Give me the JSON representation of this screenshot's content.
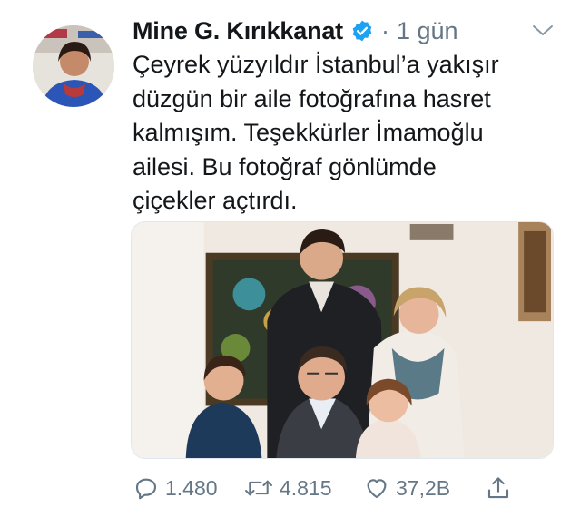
{
  "tweet": {
    "author": {
      "name": "Mine G. Kırıkkanat",
      "verified": true,
      "avatar_icon": "profile-photo"
    },
    "separator": "·",
    "time": "1 gün",
    "text": "Çeyrek yüzyıldır İstanbul’a yakışır\ndüzgün bir aile fotoğrafına hasret\nkalmışım. Teşekkürler İmamoğlu\nailesi. Bu fotoğraf gönlümde\nçiçekler açtırdı.",
    "media": {
      "type": "photo"
    },
    "actions": {
      "reply": {
        "icon": "reply-icon",
        "count": "1.480"
      },
      "retweet": {
        "icon": "retweet-icon",
        "count": "4.815"
      },
      "like": {
        "icon": "heart-icon",
        "count": "37,2B"
      },
      "share": {
        "icon": "share-icon"
      }
    },
    "colors": {
      "text": "#14171a",
      "secondary": "#657786",
      "verified": "#1da1f2"
    }
  }
}
